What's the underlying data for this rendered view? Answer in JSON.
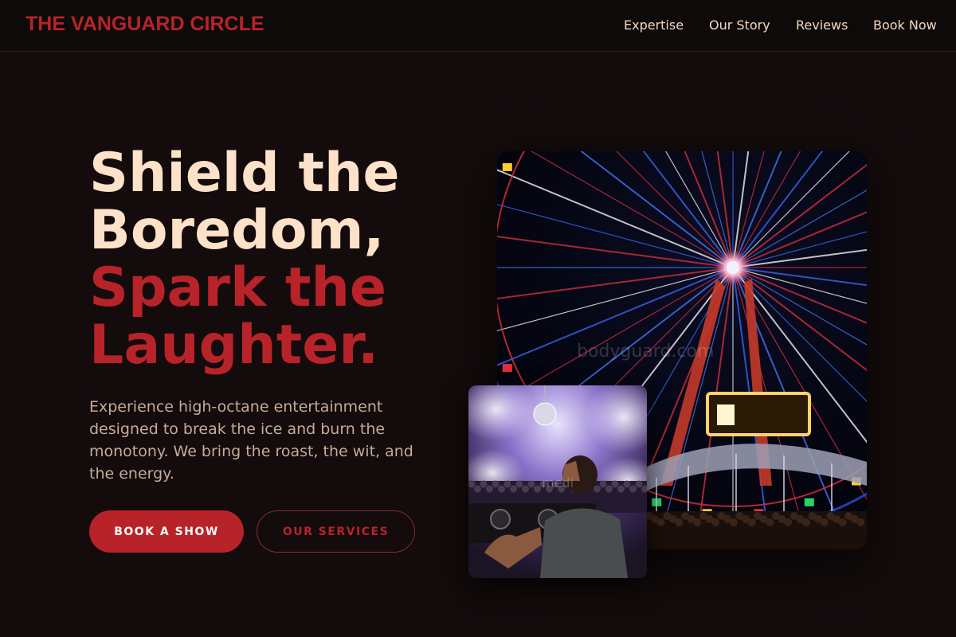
{
  "nav": {
    "brand": "THE VANGUARD CIRCLE",
    "links": [
      "Expertise",
      "Our Story",
      "Reviews",
      "Book Now"
    ]
  },
  "hero": {
    "title_lines": [
      "Shield the",
      "Boredom,",
      "Spark the",
      "Laughter."
    ],
    "description": "Experience high-octane entertainment designed to break the ice and burn the monotony. We bring the roast, the wit, and the energy.",
    "primary_button": "BOOK A SHOW",
    "secondary_button": "OUR SERVICES"
  },
  "images": {
    "main_watermark": "bodyguard.com",
    "inset_watermark": "medi"
  },
  "colors": {
    "accent": "#b8232a",
    "cream": "#fde1c8",
    "background": "#130b0c"
  }
}
